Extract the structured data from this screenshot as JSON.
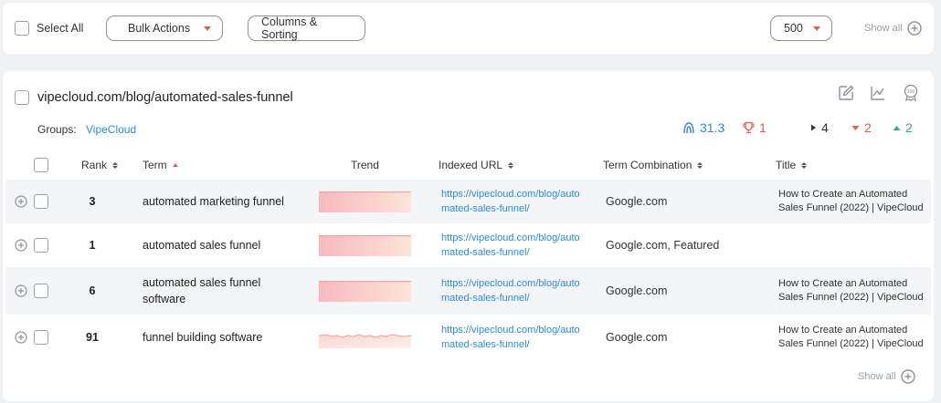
{
  "toolbar": {
    "select_all_label": "Select All",
    "bulk_actions_label": "Bulk Actions",
    "columns_sorting_label": "Columns & Sorting",
    "page_size_value": "500",
    "show_all_label": "Show all"
  },
  "card": {
    "title": "vipecloud.com/blog/automated-sales-funnel",
    "groups_label": "Groups:",
    "groups_value": "VipeCloud",
    "header_icons": [
      "edit-icon",
      "chart-icon",
      "top100-icon"
    ],
    "stats": {
      "visibility": "31.3",
      "trophy": "1",
      "unchanged": "4",
      "down": "2",
      "up": "2"
    },
    "columns": {
      "rank": "Rank",
      "term": "Term",
      "trend": "Trend",
      "indexed_url": "Indexed URL",
      "term_combination": "Term Combination",
      "title": "Title"
    },
    "rows": [
      {
        "rank": "3",
        "term": "automated marketing funnel",
        "url": "https://vipecloud.com/blog/automated-sales-funnel/",
        "combo": "Google.com",
        "title": "How to Create an Automated Sales Funnel (2022) | VipeCloud"
      },
      {
        "rank": "1",
        "term": "automated sales funnel",
        "url": "https://vipecloud.com/blog/automated-sales-funnel/",
        "combo": "Google.com, Featured",
        "title": ""
      },
      {
        "rank": "6",
        "term": "automated sales funnel software",
        "url": "https://vipecloud.com/blog/automated-sales-funnel/",
        "combo": "Google.com",
        "title": "How to Create an Automated Sales Funnel (2022) | VipeCloud"
      },
      {
        "rank": "91",
        "term": "funnel building software",
        "url": "https://vipecloud.com/blog/automated-sales-funnel/",
        "combo": "Google.com",
        "title": "How to Create an Automated Sales Funnel (2022) | VipeCloud"
      }
    ],
    "show_all_label": "Show all"
  },
  "colors": {
    "accent_blue": "#2f8bd4",
    "down_red": "#e65a4c",
    "up_green": "#3aaa7a",
    "trend_fill": "#fbd3d6"
  }
}
